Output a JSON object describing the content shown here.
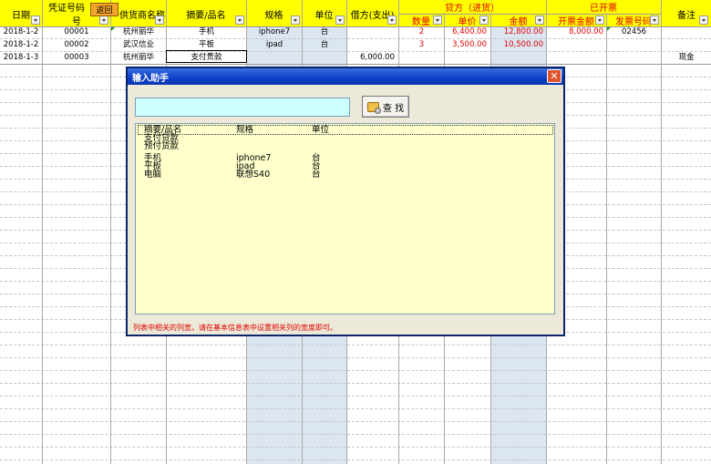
{
  "headers": {
    "date": "日期",
    "voucher_top": "凭证号码",
    "voucher_bottom": "号",
    "supplier": "供货商名称",
    "summary": "摘要/品名",
    "spec": "规格",
    "unit": "单位",
    "debit": "借方(支出)",
    "credit_group": "贷方（进货）",
    "qty": "数量",
    "price": "单价",
    "amount": "金额",
    "invoiced_group": "已开票",
    "invoice_amount": "开票金额",
    "invoice_no": "发票号码",
    "remark": "备注"
  },
  "back_button": "返回",
  "rows": [
    {
      "date": "2018-1-2",
      "voucher": "00001",
      "supplier": "杭州丽华",
      "summary": "手机",
      "spec": "iphone7",
      "unit": "台",
      "debit": "",
      "qty": "2",
      "price": "6,400.00",
      "amount": "12,800.00",
      "invoice_amount": "8,000.00",
      "invoice_no": "02456",
      "remark": ""
    },
    {
      "date": "2018-1-2",
      "voucher": "00002",
      "supplier": "武汉信业",
      "summary": "平板",
      "spec": "ipad",
      "unit": "台",
      "debit": "",
      "qty": "3",
      "price": "3,500.00",
      "amount": "10,500.00",
      "invoice_amount": "",
      "invoice_no": "",
      "remark": ""
    },
    {
      "date": "2018-1-3",
      "voucher": "00003",
      "supplier": "杭州丽华",
      "summary": "支付贵款",
      "spec": "",
      "unit": "",
      "debit": "6,000.00",
      "qty": "",
      "price": "",
      "amount": "",
      "invoice_amount": "",
      "invoice_no": "",
      "remark": "现金"
    }
  ],
  "dialog": {
    "title": "输入助手",
    "search_value": "",
    "find_label": "查 找",
    "list_headers": [
      "摘要/品名",
      "规格",
      "单位"
    ],
    "items": [
      {
        "name": "支付贷款",
        "spec": "",
        "unit": ""
      },
      {
        "name": "预付货款",
        "spec": "",
        "unit": ""
      },
      {
        "name": "手机",
        "spec": "iphone7",
        "unit": "台"
      },
      {
        "name": "平板",
        "spec": "ipad",
        "unit": "台"
      },
      {
        "name": "电脑",
        "spec": "联想S40",
        "unit": "台"
      }
    ],
    "hint": "列表中相关的列宽，请在基本信息表中设置相关列的宽度即可。"
  },
  "colors": {
    "header_yellow": "#ffff00",
    "column_blue": "#dce6f1",
    "dialog_title": "#0b3fc8",
    "list_bg": "#ffffcc",
    "search_bg": "#ccffff",
    "red_text": "#e00000"
  }
}
